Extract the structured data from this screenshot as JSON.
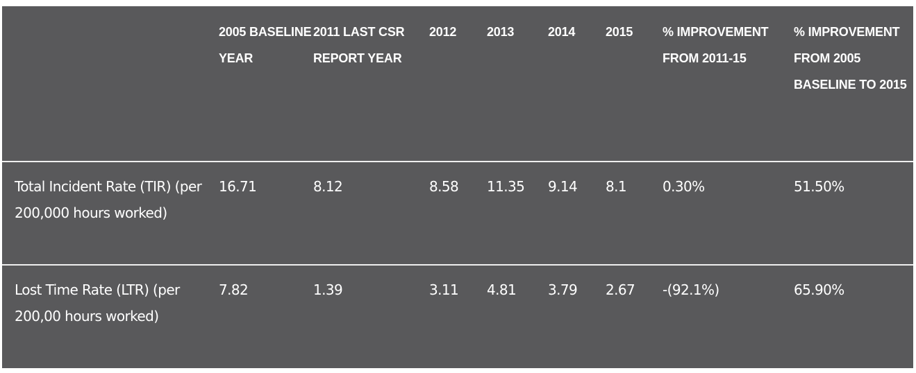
{
  "table": {
    "headers": [
      "",
      "2005 BASELINE YEAR",
      "2011 LAST CSR REPORT YEAR",
      "2012",
      "2013",
      "2014",
      "2015",
      "% IMPROVEMENT FROM 2011-15",
      "% IMPROVEMENT FROM 2005 BASELINE TO 2015"
    ],
    "rows": [
      {
        "label": "Total Incident Rate (TIR) (per 200,000 hours worked)",
        "cells": [
          "16.71",
          "8.12",
          "8.58",
          "11.35",
          "9.14",
          "8.1",
          "0.30%",
          "51.50%"
        ]
      },
      {
        "label": "Lost Time Rate (LTR) (per 200,00 hours worked)",
        "cells": [
          "7.82",
          "1.39",
          "3.11",
          "4.81",
          "3.79",
          "2.67",
          "-(92.1%)",
          "65.90%"
        ]
      }
    ]
  },
  "colors": {
    "table_background": "#59595b",
    "text": "#ffffff",
    "divider": "#f0f0f0",
    "page_background": "#ffffff"
  }
}
